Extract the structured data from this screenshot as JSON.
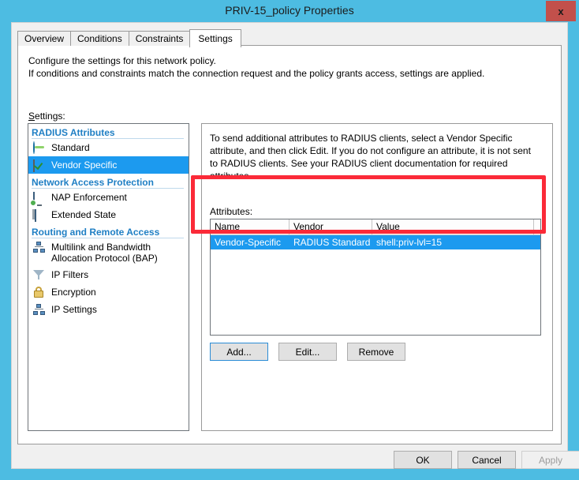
{
  "window": {
    "title": "PRIV-15_policy Properties",
    "close_label": "x",
    "titlebar_color": "#4DBCE2",
    "close_button_color": "#C2504B"
  },
  "tabs": [
    {
      "label": "Overview",
      "active": false
    },
    {
      "label": "Conditions",
      "active": false
    },
    {
      "label": "Constraints",
      "active": false
    },
    {
      "label": "Settings",
      "active": true
    }
  ],
  "settings_page": {
    "intro_line1": "Configure the settings for this network policy.",
    "intro_line2": "If conditions and constraints match the connection request and the policy grants access, settings are applied.",
    "settings_label_prefix": "S",
    "settings_label_rest": "ettings:",
    "tree": {
      "groups": [
        {
          "header": "RADIUS Attributes",
          "items": [
            {
              "label": "Standard",
              "icon": "globe-icon",
              "selected": false
            },
            {
              "label": "Vendor Specific",
              "icon": "vendor-specific-icon",
              "selected": true
            }
          ]
        },
        {
          "header": "Network Access Protection",
          "items": [
            {
              "label": "NAP Enforcement",
              "icon": "monitor-shield-icon",
              "selected": false
            },
            {
              "label": "Extended State",
              "icon": "monitor-icon",
              "selected": false
            }
          ]
        },
        {
          "header": "Routing and Remote Access",
          "items": [
            {
              "label": "Multilink and Bandwidth Allocation Protocol (BAP)",
              "icon": "network-nodes-icon",
              "selected": false
            },
            {
              "label": "IP Filters",
              "icon": "funnel-icon",
              "selected": false
            },
            {
              "label": "Encryption",
              "icon": "lock-icon",
              "selected": false
            },
            {
              "label": "IP Settings",
              "icon": "network-nodes-icon",
              "selected": false
            }
          ]
        }
      ]
    },
    "description": "To send additional attributes to RADIUS clients, select a Vendor Specific attribute, and then click Edit. If you do not configure an attribute, it is not sent to RADIUS clients. See your RADIUS client documentation for required attributes.",
    "attributes": {
      "label": "Attributes:",
      "columns": [
        "Name",
        "Vendor",
        "Value",
        ""
      ],
      "rows": [
        {
          "name": "Vendor-Specific",
          "vendor": "RADIUS Standard",
          "value": "shell:priv-lvl=15",
          "selected": true
        }
      ],
      "buttons": [
        {
          "label": "Add...",
          "enabled": true,
          "focused": true
        },
        {
          "label": "Edit...",
          "enabled": true,
          "focused": false
        },
        {
          "label": "Remove",
          "enabled": true,
          "focused": false
        }
      ]
    }
  },
  "annotation": {
    "color": "#FB2A38",
    "shape": "rectangle-highlight"
  },
  "footer": {
    "ok": "OK",
    "cancel": "Cancel",
    "apply": "Apply",
    "apply_enabled": false
  }
}
